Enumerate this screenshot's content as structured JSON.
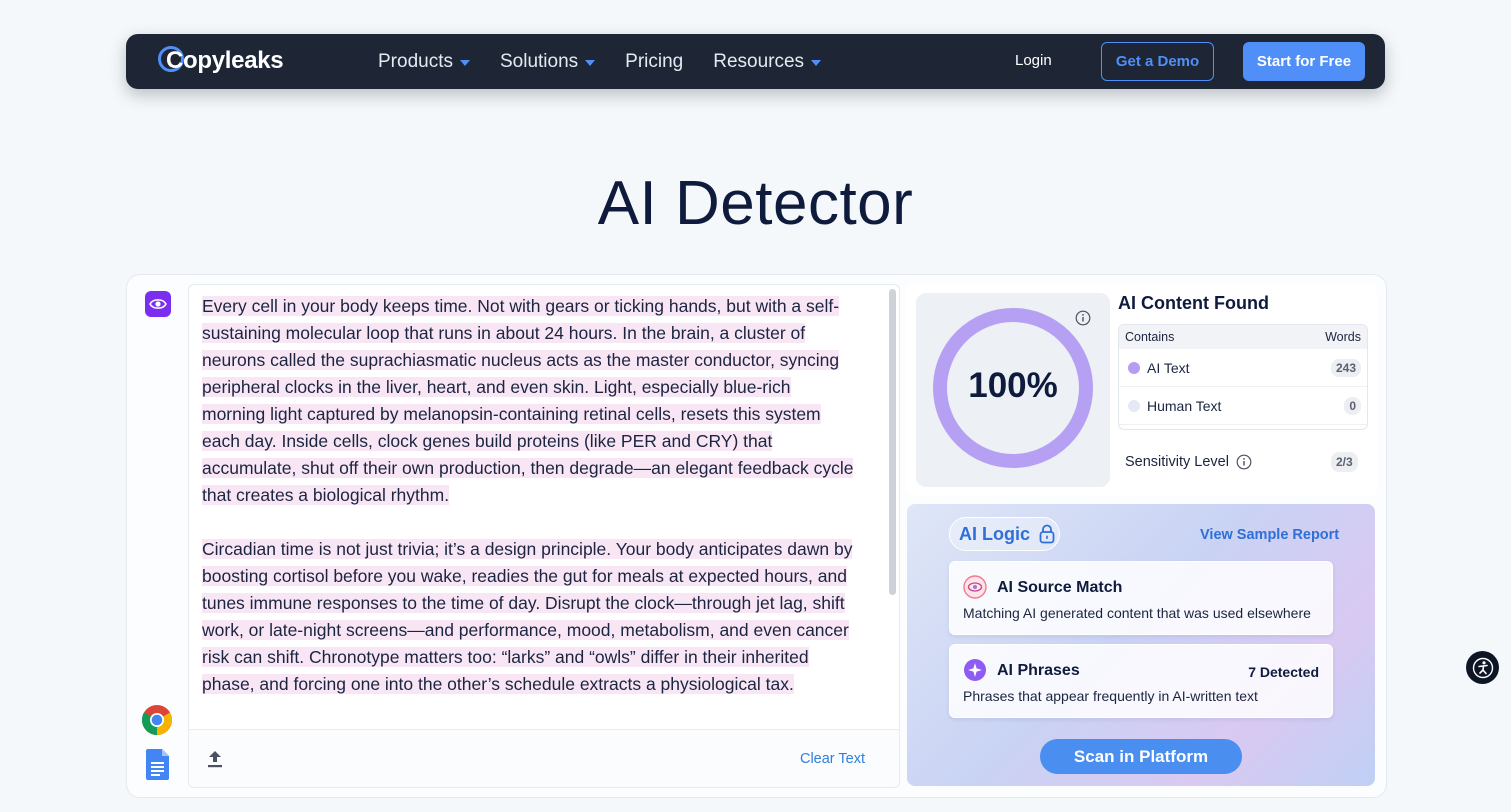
{
  "nav": {
    "logo": "Copyleaks",
    "items": [
      {
        "label": "Products",
        "dropdown": true
      },
      {
        "label": "Solutions",
        "dropdown": true
      },
      {
        "label": "Pricing",
        "dropdown": false
      },
      {
        "label": "Resources",
        "dropdown": true
      }
    ],
    "login": "Login",
    "demo": "Get a Demo",
    "start": "Start for Free"
  },
  "page_title": "AI Detector",
  "editor": {
    "paragraphs": [
      "Every cell in your body keeps time. Not with gears or ticking hands, but with a self-sustaining molecular loop that runs in about 24 hours. In the brain, a cluster of neurons called the suprachiasmatic nucleus acts as the master conductor, syncing peripheral clocks in the liver, heart, and even skin. Light, especially blue-rich morning light captured by melanopsin-containing retinal cells, resets this system each day. Inside cells, clock genes build proteins (like PER and CRY) that accumulate, shut off their own production, then degrade—an elegant feedback cycle that creates a biological rhythm.",
      "Circadian time is not just trivia; it’s a design principle. Your body anticipates dawn by boosting cortisol before you wake, readies the gut for meals at expected hours, and tunes immune responses to the time of day. Disrupt the clock—through jet lag, shift work, or late-night screens—and performance, mood, metabolism, and even cancer risk can shift. Chronotype matters too: “larks” and “owls” differ in their inherited phase, and forcing one into the other’s schedule extracts a physiological tax."
    ],
    "clear_text": "Clear Text"
  },
  "result": {
    "percent": "100%",
    "percent_value": 100,
    "title": "AI Content Found",
    "table_head": {
      "left": "Contains",
      "right": "Words"
    },
    "rows": [
      {
        "label": "AI Text",
        "count": "243",
        "color": "#b69cf2"
      },
      {
        "label": "Human Text",
        "count": "0",
        "color": "#e4e9f5"
      }
    ],
    "sensitivity_label": "Sensitivity Level",
    "sensitivity_value": "2/3"
  },
  "logic": {
    "title": "AI Logic",
    "sample_link": "View Sample Report",
    "cards": [
      {
        "title": "AI Source Match",
        "desc": "Matching AI generated content that was used elsewhere",
        "badge": ""
      },
      {
        "title": "AI Phrases",
        "desc": "Phrases that appear frequently in AI-written text",
        "badge": "7 Detected"
      }
    ],
    "scan_button": "Scan in Platform"
  },
  "colors": {
    "accent": "#4f8ff7",
    "nav_bg": "#1e2636",
    "ai_purple": "#b69cf2",
    "highlight": "#f9e6f5"
  }
}
